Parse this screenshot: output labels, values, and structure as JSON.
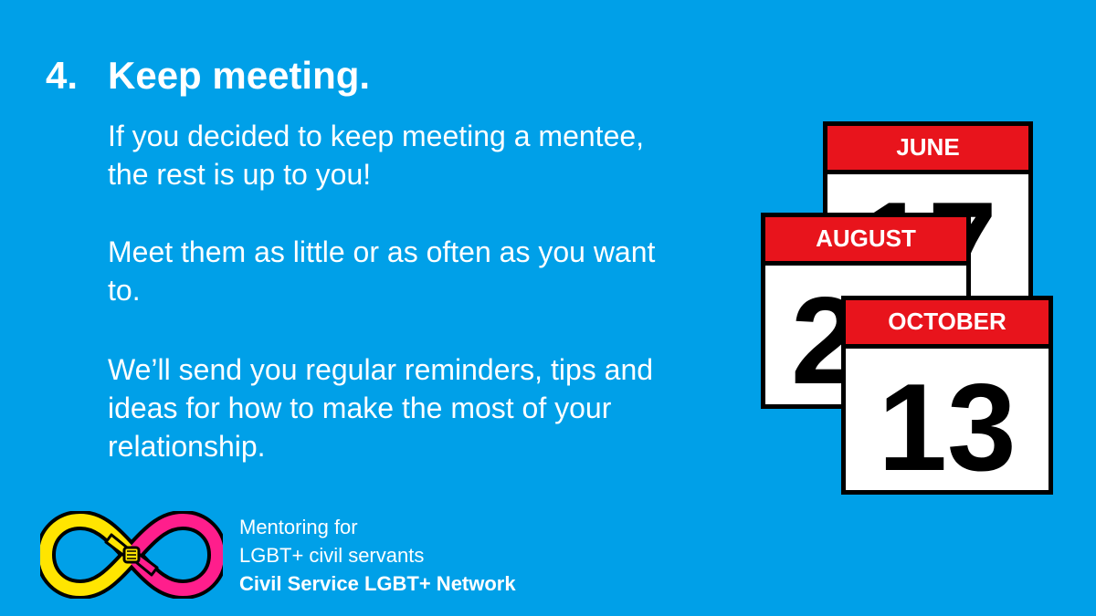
{
  "heading": {
    "number": "4.",
    "title": "Keep meeting."
  },
  "paragraphs": [
    "If you decided to keep meeting a mentee, the rest is up to you!",
    "Meet them as little or as often as you want to.",
    "We’ll send you regular reminders, tips and ideas for how to make the most of your relationship."
  ],
  "calendars": [
    {
      "month": "JUNE",
      "day": "17"
    },
    {
      "month": "AUGUST",
      "day": "24"
    },
    {
      "month": "OCTOBER",
      "day": "13"
    }
  ],
  "footer": {
    "line1": "Mentoring for",
    "line2": "LGBT+ civil servants",
    "line3": "Civil Service LGBT+ Network"
  },
  "logo": {
    "icon": "infinity-hands-icon"
  },
  "colors": {
    "background": "#00a0e8",
    "calendar_header": "#e8141c",
    "logo_yellow": "#ffe500",
    "logo_pink": "#ff1e8c"
  }
}
